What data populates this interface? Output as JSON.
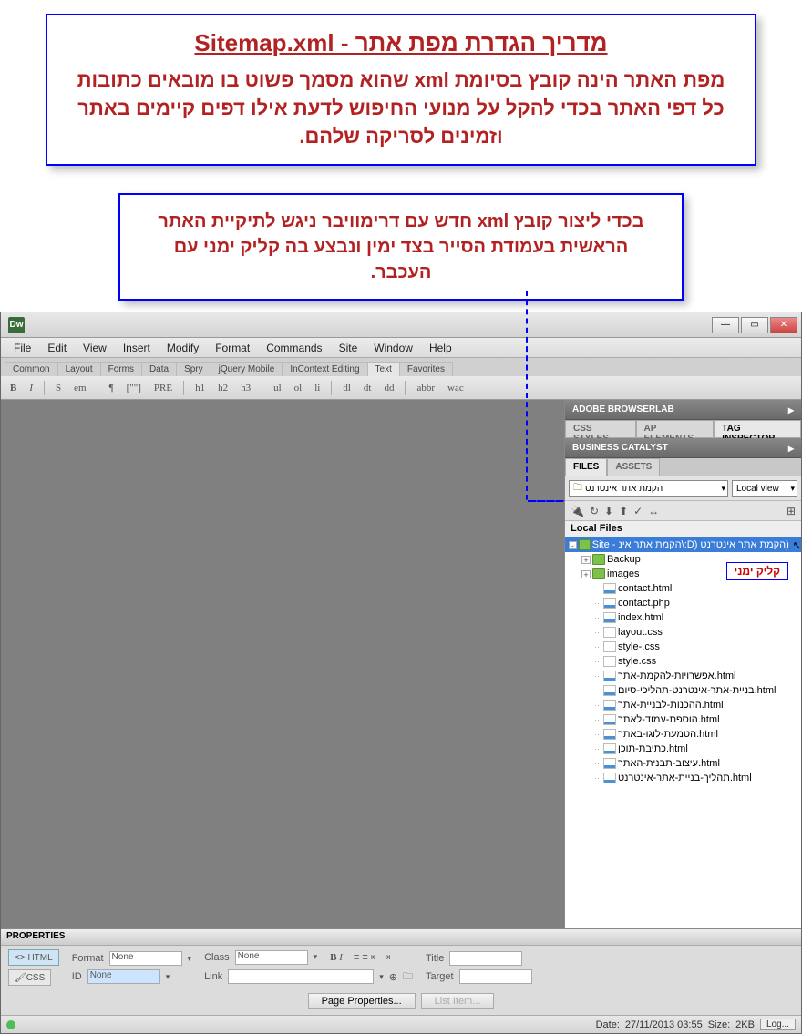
{
  "instruction1": {
    "title": "מדריך הגדרת מפת אתר - Sitemap.xml",
    "body": "מפת האתר הינה קובץ בסיומת xml שהוא מסמך פשוט בו מובאים כתובות כל דפי האתר בכדי להקל על מנועי החיפוש לדעת אילו דפים קיימים באתר וזמינים לסריקה שלהם."
  },
  "instruction2": {
    "body": "בכדי ליצור קובץ xml חדש עם דרימוויבר ניגש לתיקיית האתר הראשית בעמודת הסייר בצד ימין ונבצע בה קליק ימני עם העכבר."
  },
  "app": {
    "logo": "Dw",
    "menu": [
      "File",
      "Edit",
      "View",
      "Insert",
      "Modify",
      "Format",
      "Commands",
      "Site",
      "Window",
      "Help"
    ],
    "doc_tabs": [
      "Common",
      "Layout",
      "Forms",
      "Data",
      "Spry",
      "jQuery Mobile",
      "InContext Editing",
      "Text",
      "Favorites"
    ],
    "doc_tab_active": "Text",
    "toolbar": [
      "B",
      "I",
      "S",
      "em",
      "¶",
      "[\"\"]",
      "PRE",
      "h1",
      "h2",
      "h3",
      "ul",
      "ol",
      "li",
      "dl",
      "dt",
      "dd",
      "abbr",
      "wac"
    ]
  },
  "panels": {
    "browserlab": "ADOBE BROWSERLAB",
    "style_tabs": [
      "CSS STYLES",
      "AP ELEMENTS",
      "TAG INSPECTOR"
    ],
    "style_tab_active": "TAG INSPECTOR",
    "bc": "BUSINESS CATALYST",
    "files_tabs": [
      "FILES",
      "ASSETS"
    ],
    "files_tab_active": "FILES",
    "site_combo": "הקמת אתר אינטרנט",
    "view_combo": "Local view",
    "local_files_hdr": "Local Files",
    "root": "Site - הקמת אתר אינ\\:D) הקמת אתר אינטרנט)",
    "tree": [
      {
        "t": "folder",
        "exp": "+",
        "indent": 1,
        "name": "Backup"
      },
      {
        "t": "folder",
        "exp": "+",
        "indent": 1,
        "name": "images"
      },
      {
        "t": "html",
        "indent": 2,
        "name": "contact.html"
      },
      {
        "t": "html",
        "indent": 2,
        "name": "contact.php"
      },
      {
        "t": "html",
        "indent": 2,
        "name": "index.html"
      },
      {
        "t": "css",
        "indent": 2,
        "name": "layout.css"
      },
      {
        "t": "css",
        "indent": 2,
        "name": "style-.css"
      },
      {
        "t": "css",
        "indent": 2,
        "name": "style.css"
      },
      {
        "t": "html",
        "indent": 2,
        "name": "אפשרויות-להקמת-אתר.html"
      },
      {
        "t": "html",
        "indent": 2,
        "name": "בניית-אתר-אינטרנט-תהליכי-סיום.html"
      },
      {
        "t": "html",
        "indent": 2,
        "name": "ההכנות-לבניית-אתר.html"
      },
      {
        "t": "html",
        "indent": 2,
        "name": "הוספת-עמוד-לאתר.html"
      },
      {
        "t": "html",
        "indent": 2,
        "name": "הטמעת-לוגו-באתר.html"
      },
      {
        "t": "html",
        "indent": 2,
        "name": "כתיבת-תוכן.html"
      },
      {
        "t": "html",
        "indent": 2,
        "name": "עיצוב-תבנית-האתר.html"
      },
      {
        "t": "html",
        "indent": 2,
        "name": "תהליך-בניית-אתר-אינטרנט.html"
      }
    ],
    "rclick_label": "קליק ימני"
  },
  "properties": {
    "hdr": "PROPERTIES",
    "html_btn": "<> HTML",
    "css_btn": "CSS",
    "format_lbl": "Format",
    "format_val": "None",
    "id_lbl": "ID",
    "id_val": "None",
    "class_lbl": "Class",
    "class_val": "None",
    "link_lbl": "Link",
    "link_val": "",
    "title_lbl": "Title",
    "target_lbl": "Target",
    "page_props": "Page Properties...",
    "list_item": "List Item..."
  },
  "status": {
    "date_lbl": "Date:",
    "date": "27/11/2013 03:55",
    "size_lbl": "Size:",
    "size": "2KB",
    "log": "Log..."
  }
}
